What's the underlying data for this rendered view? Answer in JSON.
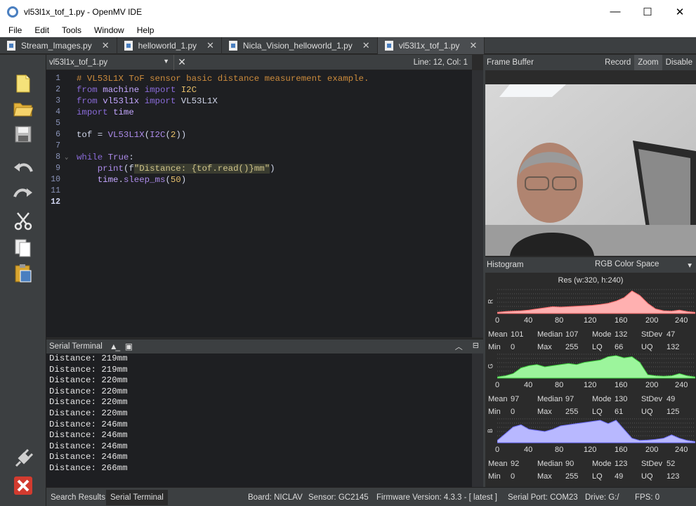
{
  "window": {
    "title": "vl53l1x_tof_1.py - OpenMV IDE",
    "min": "—",
    "max": "☐",
    "close": "✕"
  },
  "menu": [
    "File",
    "Edit",
    "Tools",
    "Window",
    "Help"
  ],
  "tabs": [
    {
      "label": "Stream_Images.py",
      "close": "✕"
    },
    {
      "label": "helloworld_1.py",
      "close": "✕"
    },
    {
      "label": "Nicla_Vision_helloworld_1.py",
      "close": "✕"
    },
    {
      "label": "vl53l1x_tof_1.py",
      "close": "✕"
    }
  ],
  "editor": {
    "file": "vl53l1x_tof_1.py",
    "close": "✕",
    "position": "Line: 12, Col: 1",
    "line_numbers": [
      "1",
      "2",
      "3",
      "4",
      "5",
      "6",
      "7",
      "8",
      "9",
      "10",
      "11",
      "12"
    ],
    "code": [
      "# VL53L1X ToF sensor basic distance measurement example.",
      "from machine import I2C",
      "from vl53l1x import VL53L1X",
      "import time",
      "",
      "tof = VL53L1X(I2C(2))",
      "",
      "while True:",
      "    print(f\"Distance: {tof.read()}mm\")",
      "    time.sleep_ms(50)",
      "",
      ""
    ]
  },
  "terminal": {
    "title": "Serial Terminal",
    "lines": [
      "Distance: 219mm",
      "Distance: 219mm",
      "Distance: 220mm",
      "Distance: 220mm",
      "Distance: 220mm",
      "Distance: 220mm",
      "Distance: 246mm",
      "Distance: 246mm",
      "Distance: 246mm",
      "Distance: 246mm",
      "Distance: 266mm"
    ]
  },
  "status": {
    "tab_search": "Search Results",
    "tab_terminal": "Serial Terminal",
    "board": "Board: NICLAV",
    "sensor": "Sensor: GC2145",
    "firmware": "Firmware Version: 4.3.3 - [ latest ]",
    "port": "Serial Port: COM23",
    "drive": "Drive: G:/",
    "fps": "FPS: 0"
  },
  "framebuffer": {
    "title": "Frame Buffer",
    "record": "Record",
    "zoom": "Zoom",
    "disable": "Disable"
  },
  "histogram": {
    "title": "Histogram",
    "colorspace": "RGB Color Space",
    "resolution": "Res (w:320, h:240)",
    "axis": [
      "0",
      "40",
      "80",
      "120",
      "160",
      "200",
      "240"
    ],
    "channels": [
      {
        "name": "R",
        "color": "#ffb0b0",
        "stroke": "#ff6b6b",
        "mean": "101",
        "median": "107",
        "mode": "132",
        "stdev": "47",
        "min": "0",
        "max": "255",
        "lq": "66",
        "uq": "132",
        "profile": [
          0.05,
          0.08,
          0.1,
          0.12,
          0.15,
          0.2,
          0.25,
          0.3,
          0.28,
          0.3,
          0.32,
          0.34,
          0.36,
          0.4,
          0.45,
          0.55,
          0.7,
          1.0,
          0.8,
          0.45,
          0.2,
          0.12,
          0.1,
          0.15,
          0.08,
          0.05
        ]
      },
      {
        "name": "G",
        "color": "#9cf59c",
        "stroke": "#40d040",
        "mean": "97",
        "median": "97",
        "mode": "130",
        "stdev": "49",
        "min": "0",
        "max": "255",
        "lq": "61",
        "uq": "125",
        "profile": [
          0.05,
          0.1,
          0.2,
          0.45,
          0.55,
          0.6,
          0.5,
          0.55,
          0.6,
          0.65,
          0.6,
          0.7,
          0.75,
          0.8,
          0.95,
          1.0,
          0.9,
          0.95,
          0.7,
          0.15,
          0.1,
          0.08,
          0.1,
          0.2,
          0.1,
          0.05
        ]
      },
      {
        "name": "B",
        "color": "#b8b8ff",
        "stroke": "#7070ff",
        "mean": "92",
        "median": "90",
        "mode": "123",
        "stdev": "52",
        "min": "0",
        "max": "255",
        "lq": "49",
        "uq": "123",
        "profile": [
          0.1,
          0.4,
          0.7,
          0.8,
          0.6,
          0.55,
          0.5,
          0.6,
          0.75,
          0.8,
          0.85,
          0.9,
          0.95,
          1.0,
          0.85,
          1.0,
          0.6,
          0.2,
          0.1,
          0.12,
          0.15,
          0.2,
          0.35,
          0.2,
          0.1,
          0.05
        ]
      }
    ]
  }
}
